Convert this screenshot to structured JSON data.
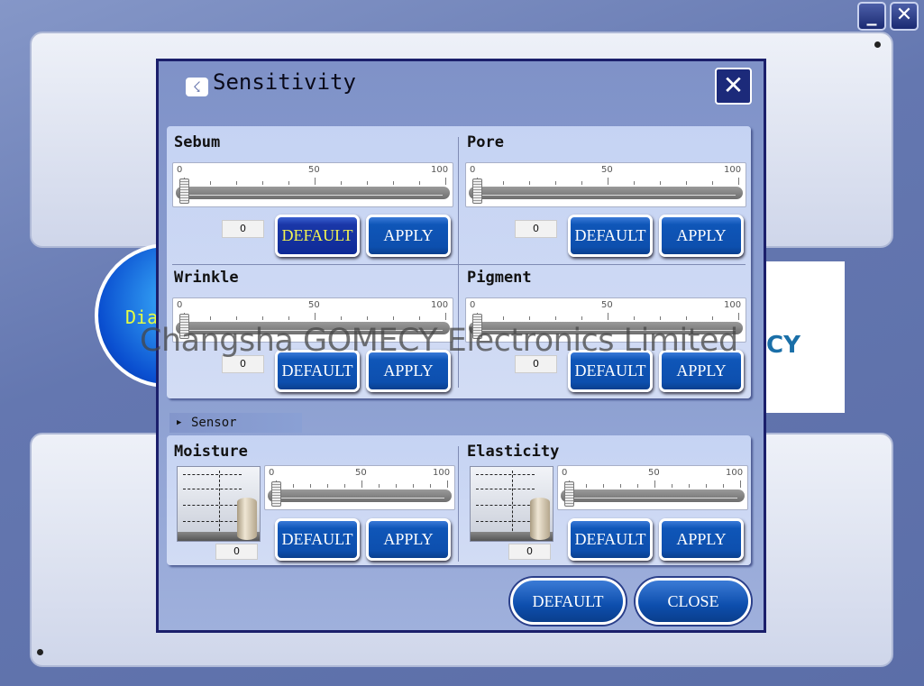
{
  "window": {
    "minimize_icon": "minimize-icon",
    "close_icon": "close-icon"
  },
  "background": {
    "circle_text": "Dia",
    "logo_text": "CY"
  },
  "watermark": "Changsha GOMECY Electronics Limited",
  "dialog": {
    "title": "Sensitivity",
    "title_icon": "sensitivity-icon",
    "close_icon": "close-x-icon",
    "scale_labels": [
      "0",
      "50",
      "100"
    ],
    "sensitivity": [
      {
        "label": "Sebum",
        "value": "0",
        "slider_value": 0,
        "default_label": "DEFAULT",
        "apply_label": "APPLY",
        "default_selected": true
      },
      {
        "label": "Pore",
        "value": "0",
        "slider_value": 0,
        "default_label": "DEFAULT",
        "apply_label": "APPLY"
      },
      {
        "label": "Wrinkle",
        "value": "0",
        "slider_value": 0,
        "default_label": "DEFAULT",
        "apply_label": "APPLY"
      },
      {
        "label": "Pigment",
        "value": "0",
        "slider_value": 0,
        "default_label": "DEFAULT",
        "apply_label": "APPLY"
      }
    ],
    "sensor_section": "Sensor",
    "sensor": [
      {
        "label": "Moisture",
        "value": "0",
        "slider_value": 0,
        "default_label": "DEFAULT",
        "apply_label": "APPLY"
      },
      {
        "label": "Elasticity",
        "value": "0",
        "slider_value": 0,
        "default_label": "DEFAULT",
        "apply_label": "APPLY"
      }
    ],
    "default_label": "DEFAULT",
    "close_label": "CLOSE"
  }
}
